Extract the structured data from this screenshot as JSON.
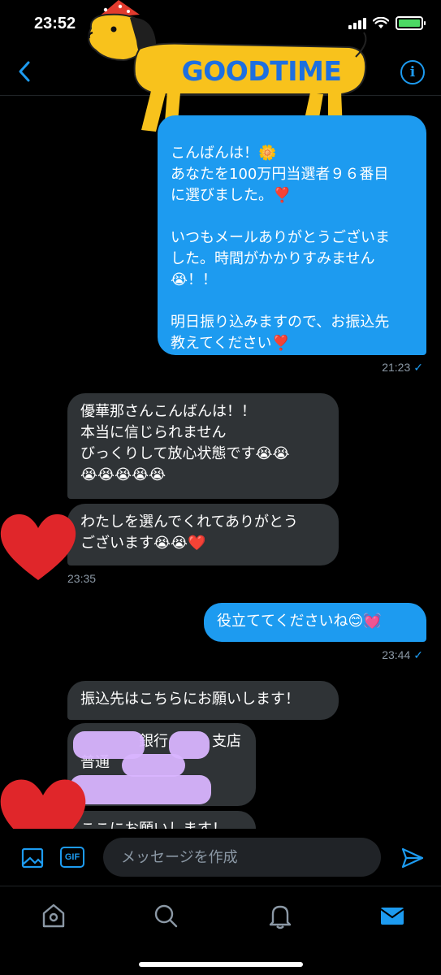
{
  "status_bar": {
    "time": "23:52"
  },
  "header": {
    "sticker_text": "GOODTIME",
    "back_icon": "chevron-left-icon",
    "info_icon": "info-icon"
  },
  "messages": [
    {
      "direction": "outgoing",
      "text": "こんばんは！🌼\nあなたを100万円当選者９６番目\nに選びました。❣️\n\nいつもメールありがとうございま\nした。時間がかかりすみません\n😭！！\n\n明日振り込みますので、お振込先\n教えてください❣️",
      "time": "21:23"
    },
    {
      "direction": "incoming",
      "text": "優華那さんこんばんは！！\n本当に信じられません\nびっくりして放心状態です😭😭\n😭😭😭😭😭"
    },
    {
      "direction": "incoming",
      "text": "わたしを選んでくれてありがとう\nございます😭😭❤️",
      "time": "23:35"
    },
    {
      "direction": "outgoing",
      "text": "役立ててくださいね😊💓",
      "time": "23:44"
    },
    {
      "direction": "incoming",
      "text": "振込先はこちらにお願いします！"
    },
    {
      "direction": "incoming",
      "text": "　　　　銀行　　　支店\n普通\n　"
    },
    {
      "direction": "incoming",
      "text": "ここにお願いします！"
    }
  ],
  "compose": {
    "placeholder": "メッセージを作成",
    "gif_label": "GIF"
  },
  "tabbar": [
    "home-icon",
    "search-icon",
    "notifications-icon",
    "messages-icon"
  ],
  "colors": {
    "accent": "#1d9bf0",
    "incoming_bubble": "#2f3336",
    "background": "#000000",
    "redaction": "#d8b4fe",
    "heart": "#e0262a"
  }
}
